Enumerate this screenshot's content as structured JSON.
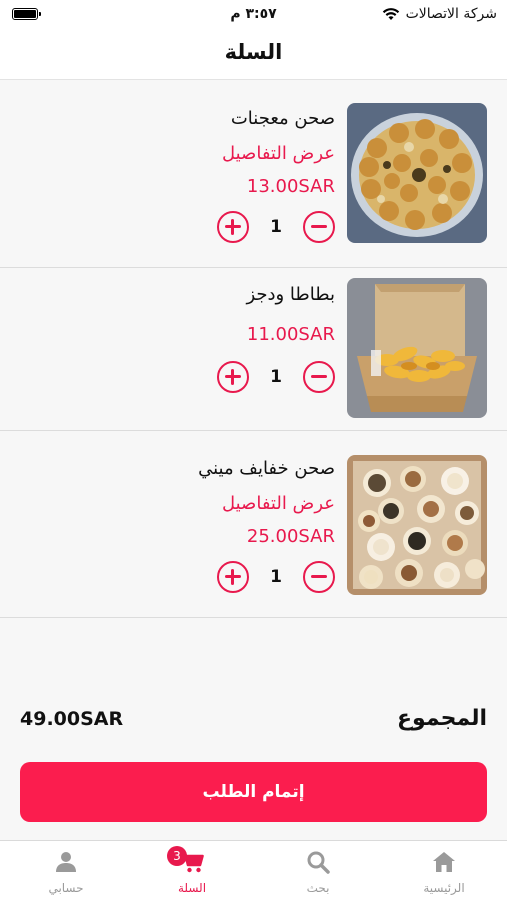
{
  "status_bar": {
    "time": "٣:٥٧ م",
    "carrier": "شركة الاتصالات",
    "battery_level": 1.0
  },
  "header": {
    "title": "السلة"
  },
  "cart": {
    "items": [
      {
        "name": "صحن معجنات",
        "details_label": "عرض التفاصيل",
        "price": "13.00SAR",
        "quantity": "1",
        "image": "pastries-plate"
      },
      {
        "name": "بطاطا ودجز",
        "details_label": "",
        "price": "11.00SAR",
        "quantity": "1",
        "image": "potato-wedges-box"
      },
      {
        "name": "صحن خفايف ميني",
        "details_label": "عرض التفاصيل",
        "price": "25.00SAR",
        "quantity": "1",
        "image": "mini-pies-tray"
      }
    ]
  },
  "summary": {
    "total_label": "المجموع",
    "total_value": "49.00SAR"
  },
  "checkout": {
    "label": "إتمام الطلب"
  },
  "tabbar": {
    "tabs": [
      {
        "label": "الرئيسية",
        "icon": "home-icon"
      },
      {
        "label": "بحث",
        "icon": "search-icon"
      },
      {
        "label": "السلة",
        "icon": "cart-icon",
        "badge": "3",
        "active": true
      },
      {
        "label": "حسابي",
        "icon": "person-icon"
      }
    ]
  },
  "colors": {
    "accent": "#e8194d",
    "button": "#fb1d4e",
    "inactive": "#9a9a9a"
  }
}
